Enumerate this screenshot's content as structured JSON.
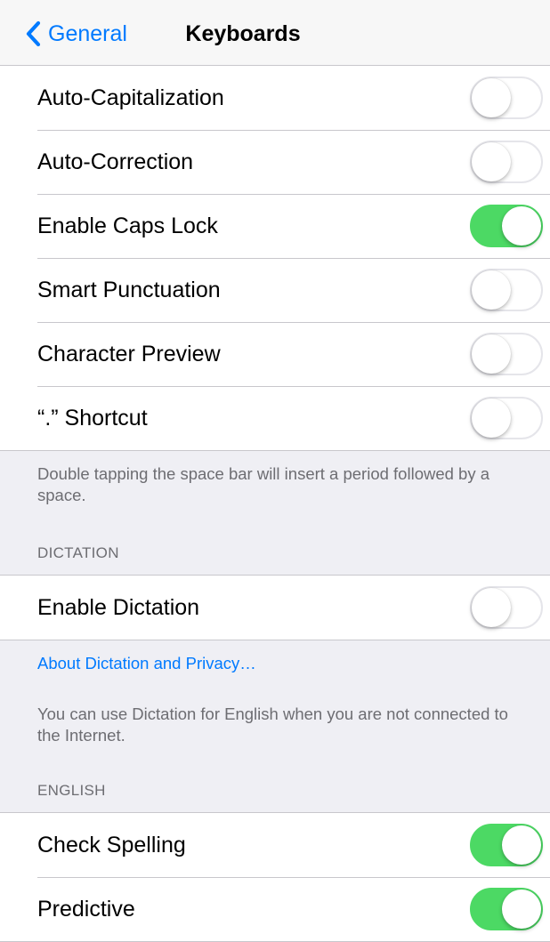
{
  "navbar": {
    "back_label": "General",
    "title": "Keyboards",
    "back_icon": "chevron-left-icon"
  },
  "colors": {
    "accent": "#007aff",
    "toggle_on": "#4cd964",
    "background": "#efeff4",
    "secondary_text": "#6d6d72"
  },
  "keyboard_settings": {
    "rows": [
      {
        "label": "Auto-Capitalization",
        "on": false
      },
      {
        "label": "Auto-Correction",
        "on": false
      },
      {
        "label": "Enable Caps Lock",
        "on": true
      },
      {
        "label": "Smart Punctuation",
        "on": false
      },
      {
        "label": "Character Preview",
        "on": false
      },
      {
        "label": "“.” Shortcut",
        "on": false
      }
    ],
    "footer": "Double tapping the space bar will insert a period followed by a space."
  },
  "dictation": {
    "header": "DICTATION",
    "rows": [
      {
        "label": "Enable Dictation",
        "on": false
      }
    ],
    "privacy_link": "About Dictation and Privacy…",
    "footer": "You can use Dictation for English when you are not connected to the Internet."
  },
  "english": {
    "header": "ENGLISH",
    "rows": [
      {
        "label": "Check Spelling",
        "on": true
      },
      {
        "label": "Predictive",
        "on": true
      }
    ]
  }
}
